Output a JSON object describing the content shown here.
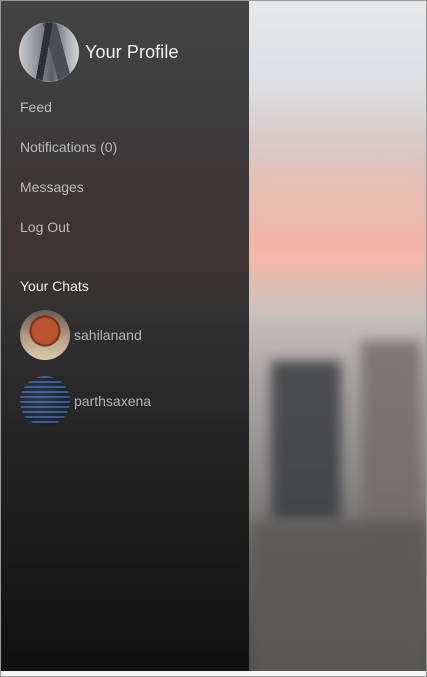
{
  "profile": {
    "name": "Your Profile",
    "avatar_icon": "city-skyscraper-photo"
  },
  "menu": {
    "items": [
      {
        "label": "Feed"
      },
      {
        "label": "Notifications (0)"
      },
      {
        "label": "Messages"
      },
      {
        "label": "Log Out"
      }
    ]
  },
  "chats": {
    "title": "Your Chats",
    "items": [
      {
        "name": "sahilanand",
        "avatar_icon": "basketball-photo"
      },
      {
        "name": "parthsaxena",
        "avatar_icon": "code-screen-photo"
      }
    ]
  },
  "colors": {
    "drawer_bg": "#262626",
    "profile_text": "#f2f2f2",
    "menu_text": "#bcbcbc",
    "chats_title_text": "#efefef",
    "accent_sky": "#f4b8a8"
  }
}
